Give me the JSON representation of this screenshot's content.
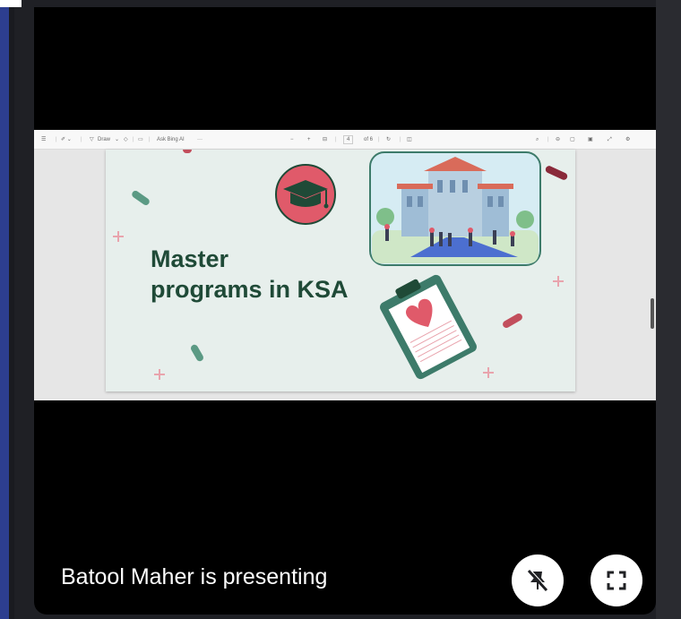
{
  "presenter_caption": "Batool Maher is presenting",
  "pdf_toolbar": {
    "draw_label": "Draw",
    "ask_label": "Ask Bing AI",
    "page_current": "4",
    "page_total": "of 6"
  },
  "slide": {
    "title_line1": "Master",
    "title_line2": "programs in KSA"
  },
  "controls": {
    "unpin_icon": "unpin-icon",
    "fullscreen_icon": "fullscreen-icon"
  },
  "colors": {
    "slide_background": "#e7efec",
    "title_color": "#1f4a37",
    "accent_red": "#e05a6a"
  }
}
